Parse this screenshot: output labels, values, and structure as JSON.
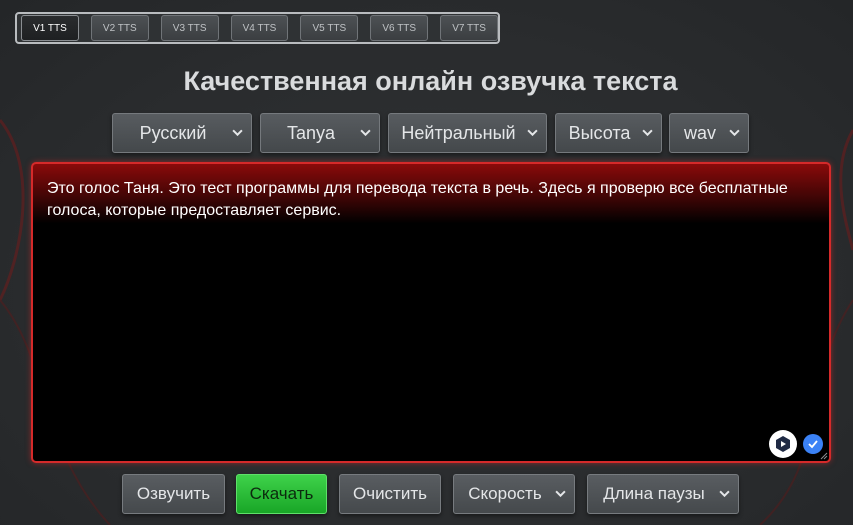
{
  "tabs": [
    {
      "label": "V1 TTS",
      "active": true
    },
    {
      "label": "V2 TTS",
      "active": false
    },
    {
      "label": "V3 TTS",
      "active": false
    },
    {
      "label": "V4 TTS",
      "active": false
    },
    {
      "label": "V5 TTS",
      "active": false
    },
    {
      "label": "V6 TTS",
      "active": false
    },
    {
      "label": "V7 TTS",
      "active": false
    }
  ],
  "title": "Качественная онлайн озвучка текста",
  "selects": {
    "language": "Русский",
    "voice": "Tanya",
    "emotion": "Нейтральный",
    "pitch": "Высота",
    "format": "wav"
  },
  "editor": {
    "text": "Это голос Таня. Это тест программы для перевода текста в речь. Здесь я проверю все бесплатные голоса, которые предоставляет сервис."
  },
  "buttons": {
    "speak": "Озвучить",
    "download": "Скачать",
    "clear": "Очистить",
    "speed": "Скорость",
    "pause_length": "Длина паузы"
  },
  "colors": {
    "accent_red": "#d52a2a",
    "download_green": "#2cbf39",
    "background": "#2a2c2e"
  },
  "icons": {
    "extension_1": "extension-badge-icon",
    "extension_2": "check-badge-icon"
  }
}
